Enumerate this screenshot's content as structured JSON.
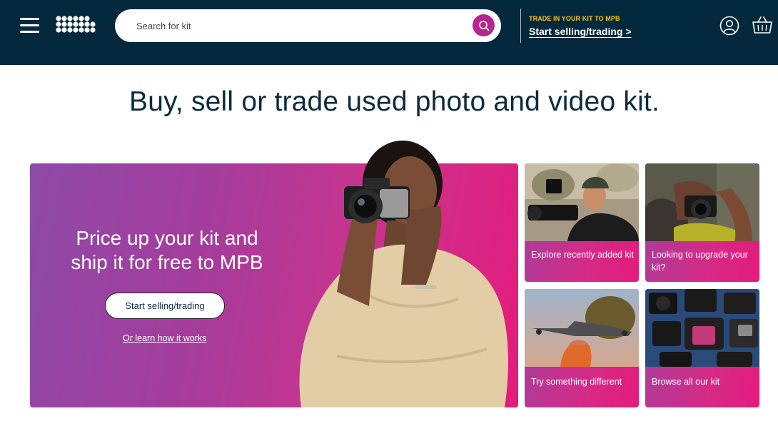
{
  "header": {
    "menu_icon": "hamburger-menu-icon",
    "logo_icon": "mpb-logo-dots-icon",
    "search": {
      "placeholder": "Search for kit",
      "value": "",
      "button_icon": "search-icon"
    },
    "trade": {
      "kicker": "TRADE IN YOUR KIT TO MPB",
      "link": "Start selling/trading >"
    },
    "account_icon": "user-account-icon",
    "basket_icon": "basket-icon"
  },
  "headline": "Buy, sell or trade used photo and video kit.",
  "hero": {
    "title": "Price up your kit and ship it for free to MPB",
    "cta": "Start selling/trading",
    "learn_link": "Or learn how it works"
  },
  "tiles": [
    {
      "label": "Explore recently added kit"
    },
    {
      "label": "Looking to upgrade your kit?"
    },
    {
      "label": "Try something different"
    },
    {
      "label": "Browse all our kit"
    }
  ],
  "colors": {
    "header_bg": "#04293d",
    "accent_yellow": "#f5c518",
    "search_button": "#b5278c",
    "hero_gradient_start": "#8e4aa8",
    "hero_gradient_end": "#e41b7c"
  }
}
